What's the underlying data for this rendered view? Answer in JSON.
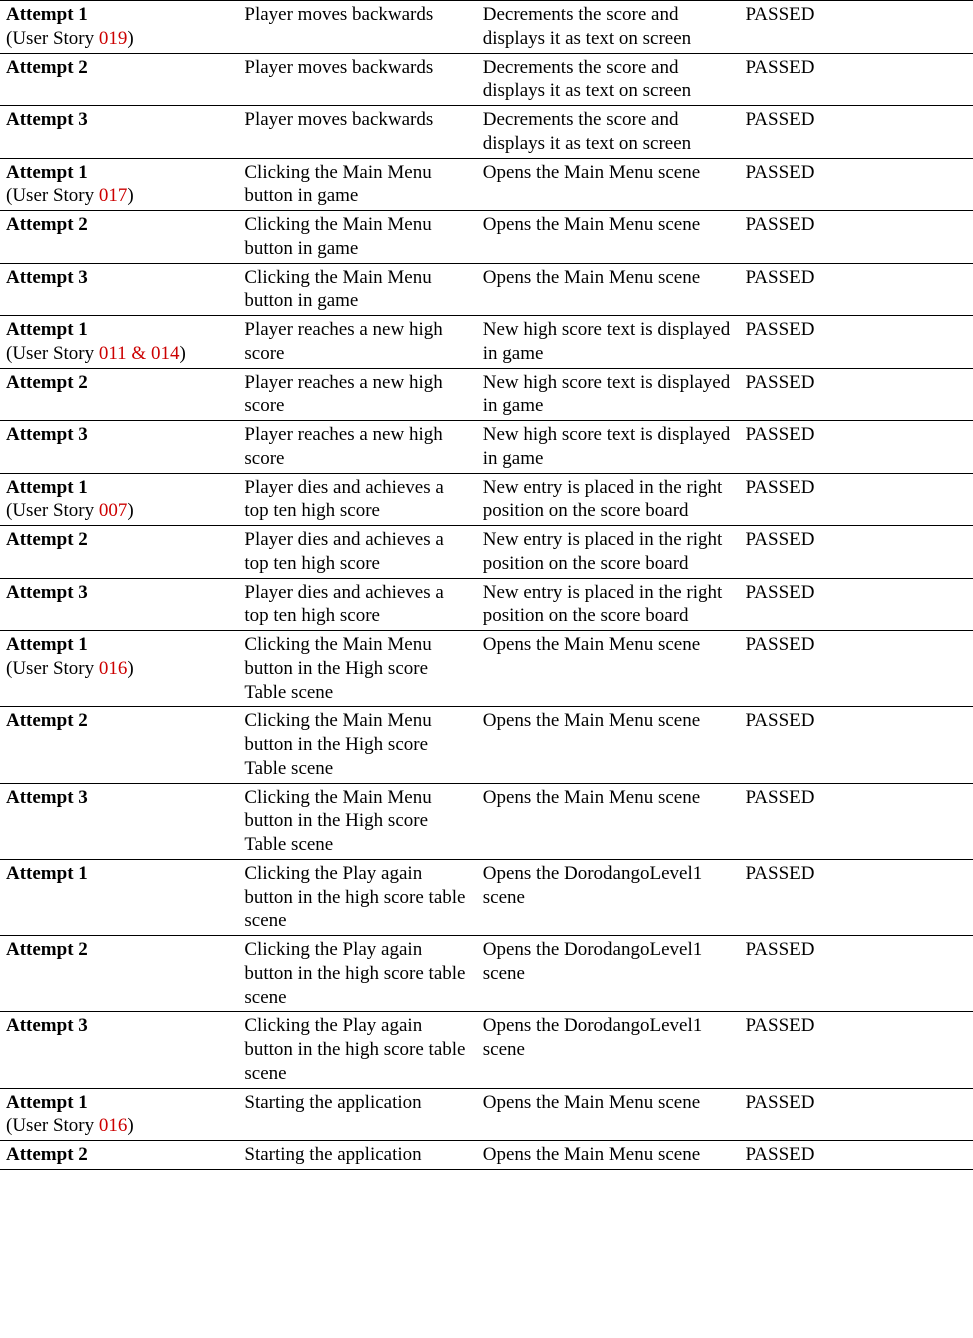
{
  "rows": [
    {
      "attempt": "Attempt 1",
      "storyPrefix": "(User Story ",
      "storyCode": "019",
      "storySuffix": ")",
      "event": "Player moves backwards",
      "response": "Decrements the score and displays it as text on screen",
      "result": "PASSED",
      "tall": false
    },
    {
      "attempt": "Attempt 2",
      "storyPrefix": "",
      "storyCode": "",
      "storySuffix": "",
      "event": "Player moves backwards",
      "response": "Decrements the score and displays it as text on screen",
      "result": "PASSED",
      "tall": false
    },
    {
      "attempt": "Attempt 3",
      "storyPrefix": "",
      "storyCode": "",
      "storySuffix": "",
      "event": "Player moves backwards",
      "response": "Decrements the score and displays it as text on screen",
      "result": "PASSED",
      "tall": false
    },
    {
      "attempt": "Attempt 1",
      "storyPrefix": "(User Story ",
      "storyCode": "017",
      "storySuffix": ")",
      "event": "Clicking the Main Menu button in game",
      "response": "Opens the Main Menu scene",
      "result": "PASSED",
      "tall": true
    },
    {
      "attempt": "Attempt 2",
      "storyPrefix": "",
      "storyCode": "",
      "storySuffix": "",
      "event": "Clicking the Main Menu button in game",
      "response": "Opens the Main Menu scene",
      "result": "PASSED",
      "tall": false
    },
    {
      "attempt": "Attempt 3",
      "storyPrefix": "",
      "storyCode": "",
      "storySuffix": "",
      "event": "Clicking the Main Menu button in game",
      "response": "Opens the Main Menu scene",
      "result": "PASSED",
      "tall": false
    },
    {
      "attempt": "Attempt 1",
      "storyPrefix": "(User Story ",
      "storyCode": "011 & 014",
      "storySuffix": ")",
      "event": "Player reaches a new high score",
      "response": "New high score text is displayed in game",
      "result": "PASSED",
      "tall": true
    },
    {
      "attempt": "Attempt 2",
      "storyPrefix": "",
      "storyCode": "",
      "storySuffix": "",
      "event": "Player reaches a new high score",
      "response": "New high score text is displayed in game",
      "result": "PASSED",
      "tall": false
    },
    {
      "attempt": "Attempt 3",
      "storyPrefix": "",
      "storyCode": "",
      "storySuffix": "",
      "event": "Player reaches a new high score",
      "response": "New high score text is displayed in game",
      "result": "PASSED",
      "tall": false
    },
    {
      "attempt": "Attempt 1",
      "storyPrefix": "(User Story ",
      "storyCode": "007",
      "storySuffix": ")",
      "event": "Player dies and achieves a top ten high score",
      "response": "New entry is placed in the right position on the score board",
      "result": "PASSED",
      "tall": false
    },
    {
      "attempt": "Attempt 2",
      "storyPrefix": "",
      "storyCode": "",
      "storySuffix": "",
      "event": "Player dies and achieves a top ten high score",
      "response": "New entry is placed in the right position on the score board",
      "result": "PASSED",
      "tall": false
    },
    {
      "attempt": "Attempt 3",
      "storyPrefix": "",
      "storyCode": "",
      "storySuffix": "",
      "event": "Player dies and achieves a top ten high score",
      "response": "New entry is placed in the right position on the score board",
      "result": "PASSED",
      "tall": false
    },
    {
      "attempt": "Attempt 1",
      "storyPrefix": "(User Story ",
      "storyCode": "016",
      "storySuffix": ")",
      "event": "Clicking the Main Menu button in the High score Table scene",
      "response": "Opens the Main Menu scene",
      "result": "PASSED",
      "tall": false
    },
    {
      "attempt": "Attempt 2",
      "storyPrefix": "",
      "storyCode": "",
      "storySuffix": "",
      "event": "Clicking the Main Menu button in the High score Table scene",
      "response": "Opens the Main Menu scene",
      "result": "PASSED",
      "tall": false
    },
    {
      "attempt": "Attempt 3",
      "storyPrefix": "",
      "storyCode": "",
      "storySuffix": "",
      "event": "Clicking the Main Menu button in the High score Table scene",
      "response": "Opens the Main Menu scene",
      "result": "PASSED",
      "tall": false
    },
    {
      "attempt": "Attempt 1",
      "storyPrefix": "",
      "storyCode": "",
      "storySuffix": "",
      "event": "Clicking the Play again button in the high score table scene",
      "response": "Opens the DorodangoLevel1 scene",
      "result": "PASSED",
      "tall": false
    },
    {
      "attempt": "Attempt 2",
      "storyPrefix": "",
      "storyCode": "",
      "storySuffix": "",
      "event": "Clicking the Play again button in the high score table scene",
      "response": "Opens the DorodangoLevel1 scene",
      "result": "PASSED",
      "tall": false
    },
    {
      "attempt": "Attempt 3",
      "storyPrefix": "",
      "storyCode": "",
      "storySuffix": "",
      "event": "Clicking the Play again button in the high score table scene",
      "response": "Opens the DorodangoLevel1 scene",
      "result": "PASSED",
      "tall": false
    },
    {
      "attempt": "Attempt 1",
      "storyPrefix": "(User Story ",
      "storyCode": "016",
      "storySuffix": ")",
      "event": "Starting the application",
      "response": "Opens the Main Menu scene",
      "result": "PASSED",
      "tall": true
    },
    {
      "attempt": "Attempt 2",
      "storyPrefix": "",
      "storyCode": "",
      "storySuffix": "",
      "event": "Starting the application",
      "response": "Opens the Main Menu scene",
      "result": "PASSED",
      "tall": false
    }
  ]
}
